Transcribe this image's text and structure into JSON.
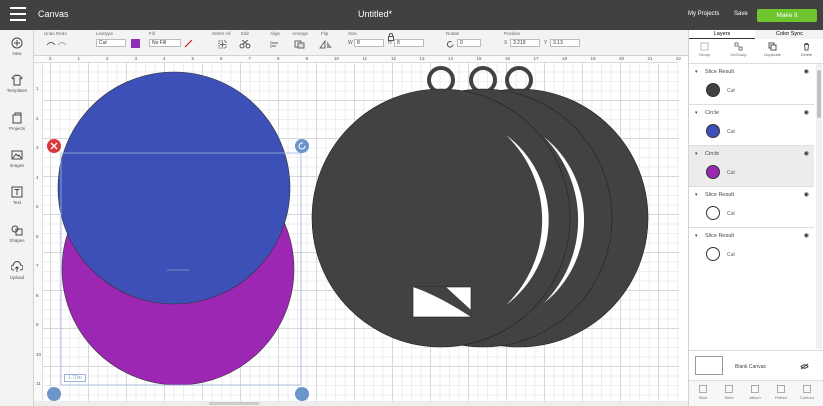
{
  "topbar": {
    "app_title": "Canvas",
    "doc_title": "Untitled*",
    "my_projects": "My Projects",
    "save": "Save",
    "make_it": "Make It"
  },
  "toolbar": {
    "undo": "Undo",
    "redo": "Redo",
    "linetype_label": "Linetype",
    "linetype_value": "Cut",
    "fill_label": "Fill",
    "fill_value": "No Fill",
    "select_all": "Select All",
    "edit": "Edit",
    "align": "Align",
    "arrange": "Arrange",
    "flip": "Flip",
    "size": "Size",
    "w_label": "W",
    "w_value": "8",
    "h_label": "H",
    "h_value": "8",
    "rotate": "Rotate",
    "rotate_value": "0",
    "position": "Position",
    "x_label": "X",
    "x_value": "3.219",
    "y_label": "Y",
    "y_value": "3.13",
    "linetype_color": "#8e2fb4"
  },
  "leftbar": [
    {
      "label": "New",
      "icon": "plus-circle-icon"
    },
    {
      "label": "Templates",
      "icon": "shirt-icon"
    },
    {
      "label": "Projects",
      "icon": "projects-icon"
    },
    {
      "label": "Images",
      "icon": "image-icon"
    },
    {
      "label": "Text",
      "icon": "text-icon"
    },
    {
      "label": "Shapes",
      "icon": "shapes-icon"
    },
    {
      "label": "Upload",
      "icon": "upload-icon"
    }
  ],
  "ruler": {
    "top": [
      "0",
      "1",
      "2",
      "3",
      "4",
      "5",
      "6",
      "7",
      "8",
      "9",
      "10",
      "11",
      "12",
      "13",
      "14",
      "15",
      "16",
      "17",
      "18",
      "19",
      "20",
      "21",
      "22"
    ],
    "left": [
      "1",
      "2",
      "3",
      "4",
      "5",
      "6",
      "7",
      "8",
      "9",
      "10",
      "11"
    ]
  },
  "canvas": {
    "size_badge": "1.70in",
    "colors": {
      "blue": "#3d50b8",
      "purple": "#9b27b3",
      "dark": "#424242"
    }
  },
  "panel": {
    "tabs": [
      "Layers",
      "Color Sync"
    ],
    "actions": [
      "Group",
      "UnGroup",
      "Duplicate",
      "Delete"
    ],
    "layers": [
      {
        "name": "Slice Result",
        "op": "Cut",
        "color": "#424242"
      },
      {
        "name": "Circle",
        "op": "Cut",
        "color": "#3d50b8"
      },
      {
        "name": "Circle",
        "op": "Cut",
        "color": "#9b27b3"
      },
      {
        "name": "Slice Result",
        "op": "Cut",
        "color": "#ffffff"
      },
      {
        "name": "Slice Result",
        "op": "Cut",
        "color": "#ffffff"
      }
    ],
    "blank_canvas": "Blank Canvas",
    "bottom_actions": [
      "Slice",
      "Weld",
      "Attach",
      "Flatten",
      "Contour"
    ]
  }
}
